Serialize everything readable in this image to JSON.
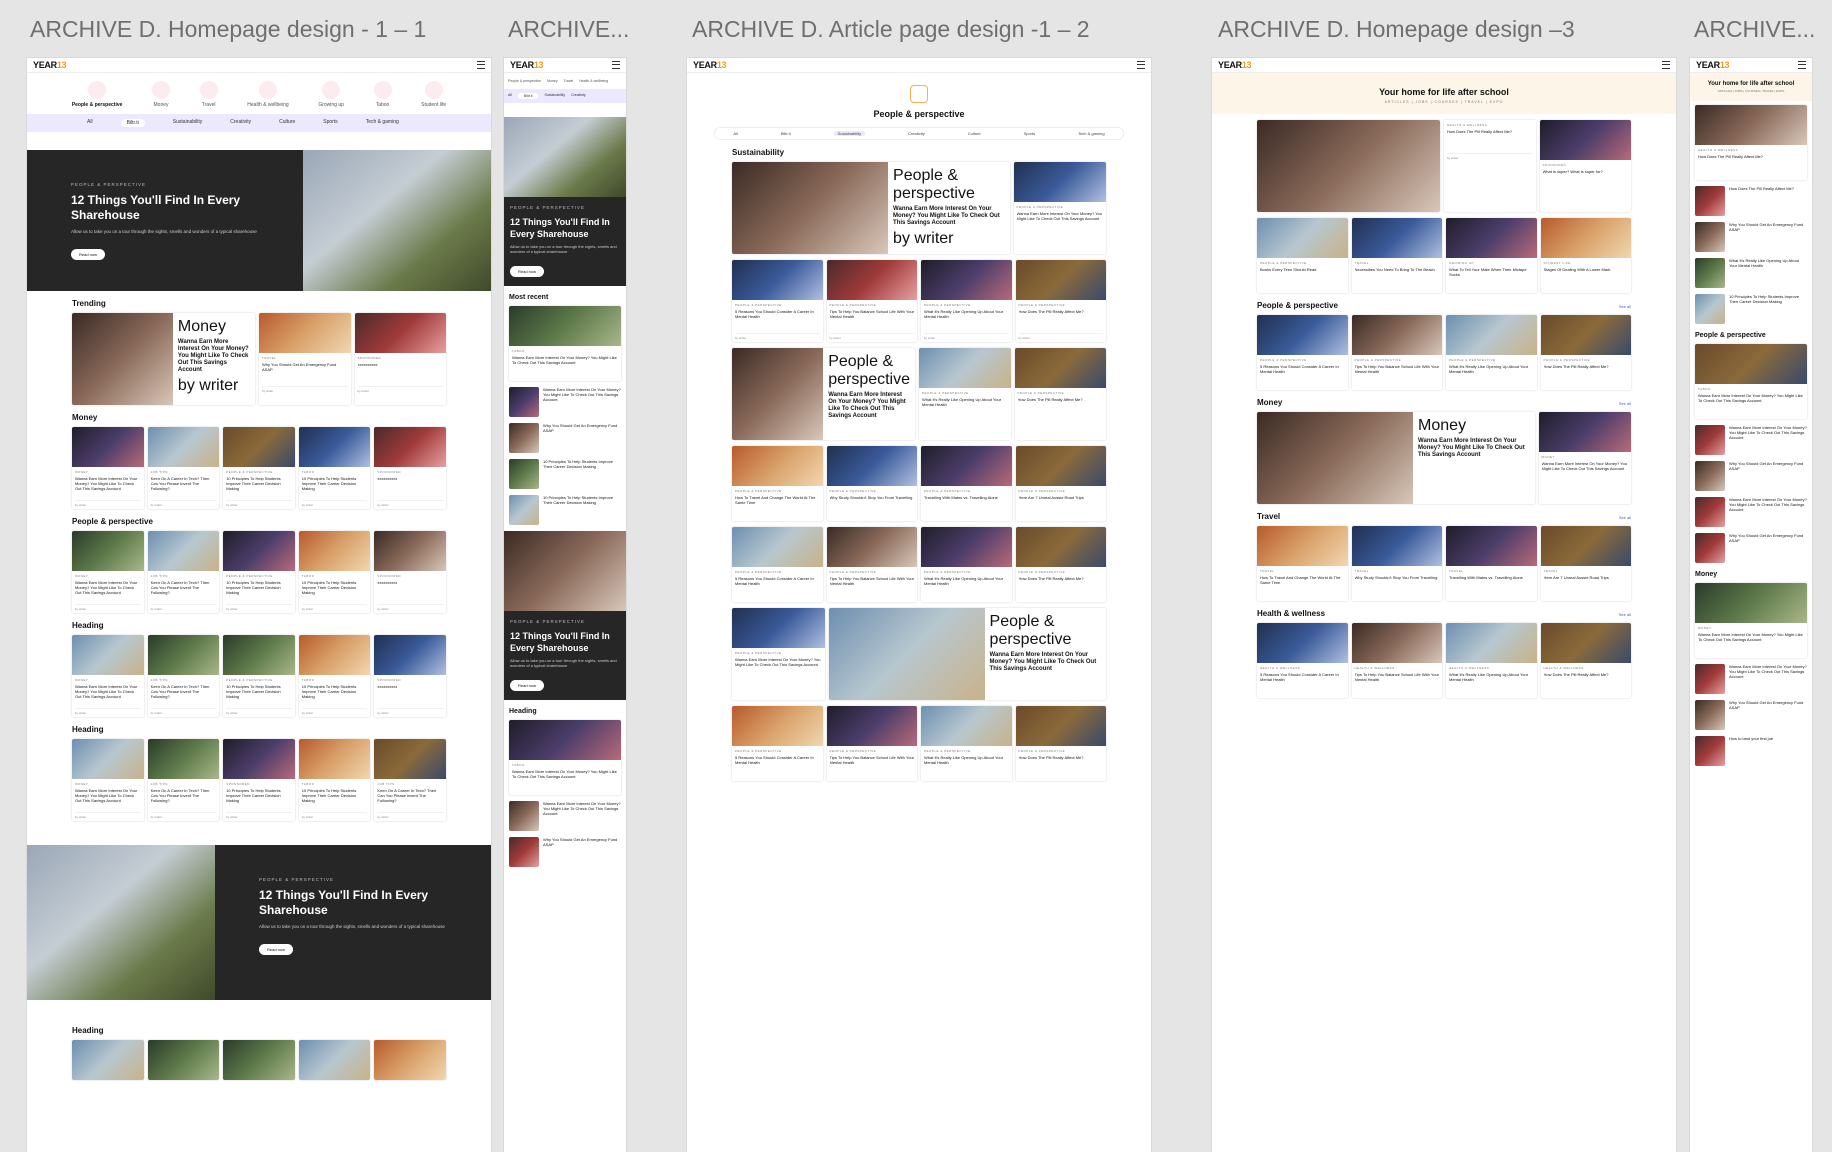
{
  "boards": [
    {
      "title": "ARCHIVE D. Homepage design - 1 – 1"
    },
    {
      "title": "ARCHIVE..."
    },
    {
      "title": "ARCHIVE D. Article page design -1 – 2"
    },
    {
      "title": "ARCHIVE D. Homepage design –3"
    },
    {
      "title": "ARCHIVE..."
    }
  ],
  "logo": "YEAR13",
  "categories": [
    "People & perspective",
    "Money",
    "Travel",
    "Health & wellbeing",
    "Growing up",
    "Taboo",
    "Student life"
  ],
  "tabs": [
    "All",
    "Biltr.ti",
    "Sustainability",
    "Creativity",
    "Culture",
    "Sports",
    "Tech & gaming"
  ],
  "hero": {
    "kicker": "People & perspective",
    "title": "12 Things You'll Find In Every Sharehouse",
    "desc": "Allow us to take you on a tour through the sights, smells and wonders of a typical sharehouse",
    "button": "Read now"
  },
  "sections": {
    "trending": "Trending",
    "money": "Money",
    "people": "People & perspective",
    "heading": "Heading",
    "most_recent": "Most recent",
    "sustainability": "Sustainability",
    "travel": "Travel",
    "health": "Health & wellness",
    "see_all": "See all"
  },
  "article_page": {
    "category_title": "People & perspective"
  },
  "home3": {
    "title": "Your home for life after school",
    "nav": "ARTICLES | JOBS | COURSES | TRAVEL | EXPO"
  },
  "cards": {
    "money_title": "Wanna Earn More Interest On Your Money? You Might Like To Check Out This Savings Account",
    "career": "Keen On A Career In Tech? Then Can You Please Invent The Following?",
    "principles": "10 Principles To Help Students Improve Their Career Decision Making",
    "emergency": "Why You Should Get An Emergency Fund ASAP",
    "sponsored": "xxxxxxxxxx",
    "reasons": "5 Reasons You Should Consider A Career In Mental Health",
    "balance": "Tips To Help You Balance School Life With Your Mental Health",
    "opening": "What It's Really Like Opening Up About Your Mental Health",
    "pill": "How Does The Pill Really Affect Me?",
    "travel_change": "How To Travel And Change The World At The Same Time",
    "quit_travel": "Why Study Shouldn't Stop You From Travelling",
    "mates": "Travelling With Mates vs. Travelling Alone",
    "roadtrips": "Here Are 7 Unreal Aussie Road Trips",
    "books": "Books Every Teen Should Read",
    "beach": "Necessities You Need To Bring To The Beach",
    "mixtape": "What To Tell Your Mate When Their Mixtape Sucks",
    "lowmark": "Stages Of Dealing With A Lower Mark",
    "super": "What is super? What is super for?",
    "firstjob": "How to land your first job",
    "author": "by writer",
    "read": "3 min read",
    "kicker_people": "People & perspective",
    "kicker_money": "Money",
    "kicker_job": "Job tips",
    "kicker_taboo": "Taboo",
    "kicker_sponsored": "Sponsored",
    "kicker_travel": "Travel",
    "kicker_health": "Health & wellness",
    "kicker_growing": "Growing up",
    "kicker_student": "Student life"
  }
}
